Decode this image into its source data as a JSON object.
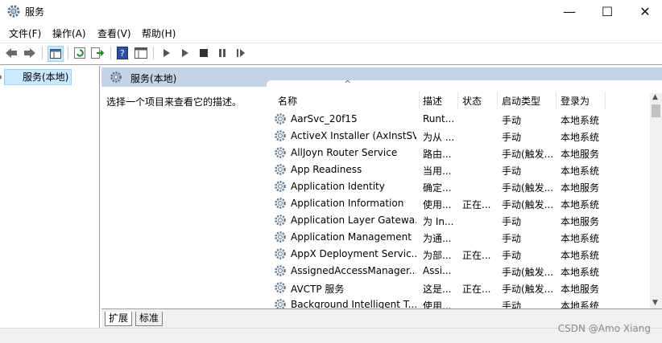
{
  "window": {
    "title": "服务",
    "minimize": "—",
    "maximize": "☐",
    "close": "✕"
  },
  "menu": [
    "文件(F)",
    "操作(A)",
    "查看(V)",
    "帮助(H)"
  ],
  "tree": {
    "root_label": "服务(本地)"
  },
  "panel": {
    "header": "服务(本地)",
    "description": "选择一个项目来查看它的描述。",
    "sort_indicator": "^",
    "columns": [
      "名称",
      "描述",
      "状态",
      "启动类型",
      "登录为"
    ],
    "rows": [
      [
        "AarSvc_20f15",
        "Runt...",
        "",
        "手动",
        "本地系统"
      ],
      [
        "ActiveX Installer (AxInstSV)",
        "为从 ...",
        "",
        "手动",
        "本地系统"
      ],
      [
        "AllJoyn Router Service",
        "路由...",
        "",
        "手动(触发...",
        "本地服务"
      ],
      [
        "App Readiness",
        "当用...",
        "",
        "手动",
        "本地系统"
      ],
      [
        "Application Identity",
        "确定...",
        "",
        "手动(触发...",
        "本地服务"
      ],
      [
        "Application Information",
        "使用...",
        "正在...",
        "手动(触发...",
        "本地系统"
      ],
      [
        "Application Layer Gatewa...",
        "为 In...",
        "",
        "手动",
        "本地服务"
      ],
      [
        "Application Management",
        "为通...",
        "",
        "手动",
        "本地系统"
      ],
      [
        "AppX Deployment Servic...",
        "为部...",
        "正在...",
        "手动",
        "本地系统"
      ],
      [
        "AssignedAccessManager...",
        "Assi...",
        "",
        "手动(触发...",
        "本地系统"
      ],
      [
        "AVCTP 服务",
        "这是...",
        "正在...",
        "手动(触发...",
        "本地服务"
      ],
      [
        "Background Intelligent T...",
        "使用...",
        "",
        "手动",
        "本地系统"
      ]
    ]
  },
  "tabs": [
    "扩展",
    "标准"
  ],
  "watermark": "CSDN @Amo Xiang"
}
